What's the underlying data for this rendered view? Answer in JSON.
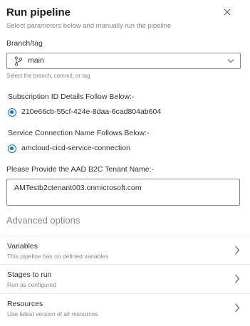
{
  "panel": {
    "title": "Run pipeline",
    "subtitle": "Select parameters below and manually run the pipeline"
  },
  "branch": {
    "label": "Branch/tag",
    "value": "main",
    "hint": "Select the branch, commit, or tag"
  },
  "subscription": {
    "label": "Subscription ID Details Follow Below:-",
    "option": "210e66cb-55cf-424e-8daa-6cad804ab604",
    "selected": true
  },
  "service_connection": {
    "label": "Service Connection Name Follows Below:-",
    "option": "amcloud-cicd-service-connection",
    "selected": true
  },
  "tenant": {
    "label": "Please Provide the AAD B2C Tenant Name:-",
    "value": "AMTestb2ctenant003.onmicrosoft.com"
  },
  "advanced": {
    "title": "Advanced options",
    "rows": [
      {
        "title": "Variables",
        "subtitle": "This pipeline has no defined variables"
      },
      {
        "title": "Stages to run",
        "subtitle": "Run as configured"
      },
      {
        "title": "Resources",
        "subtitle": "Use latest version of all resources"
      }
    ]
  },
  "icons": {
    "close": "close-icon",
    "branch": "branch-icon",
    "dropdown": "chevron-down-icon",
    "row_arrow": "chevron-right-icon"
  },
  "colors": {
    "accent": "#0078d4",
    "text": "#323130",
    "muted": "#8a8886",
    "border": "#8a8886",
    "divider": "#edebe9"
  }
}
